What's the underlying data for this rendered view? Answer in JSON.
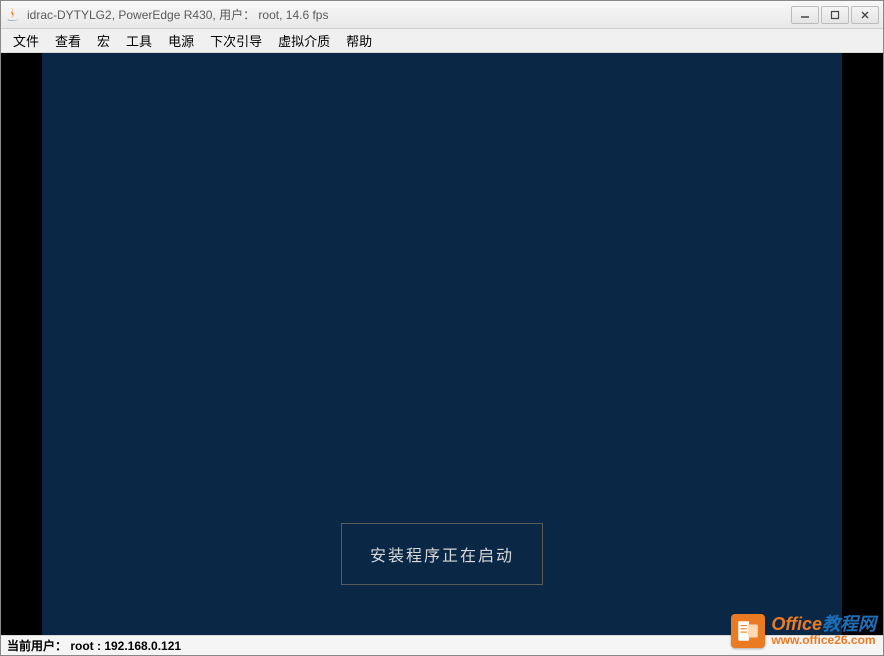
{
  "window": {
    "title": "idrac-DYTYLG2, PowerEdge R430, 用户： root, 14.6 fps"
  },
  "menu": {
    "items": [
      "文件",
      "查看",
      "宏",
      "工具",
      "电源",
      "下次引导",
      "虚拟介质",
      "帮助"
    ]
  },
  "remote": {
    "message": "安装程序正在启动"
  },
  "status": {
    "text": "当前用户： root : 192.168.0.121"
  },
  "watermark": {
    "brand_part1": "Office",
    "brand_part2": "教程网",
    "url": "www.office26.com"
  }
}
